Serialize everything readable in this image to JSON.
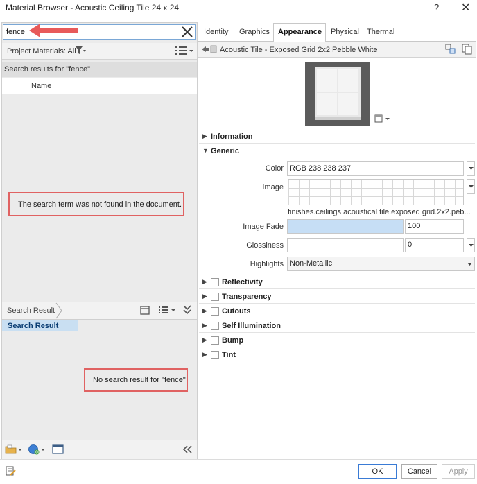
{
  "window": {
    "title": "Material Browser - Acoustic Ceiling Tile 24 x 24",
    "help_label": "?",
    "close_label": "✕"
  },
  "left_panel": {
    "search": {
      "value": "fence"
    },
    "project_materials_label": "Project Materials: All",
    "search_results_label": "Search results for \"fence\"",
    "column_name": "Name",
    "not_found_message": "The search term was not found in the document."
  },
  "search_result_panel": {
    "breadcrumb": "Search Result",
    "tree_item": "Search Result",
    "no_result_message": "No search result for \"fence\""
  },
  "tabs": [
    {
      "label": "Identity"
    },
    {
      "label": "Graphics"
    },
    {
      "label": "Appearance"
    },
    {
      "label": "Physical"
    },
    {
      "label": "Thermal"
    }
  ],
  "asset": {
    "name": "Acoustic Tile - Exposed Grid 2x2 Pebble White"
  },
  "sections": {
    "information": "Information",
    "generic": "Generic",
    "reflectivity": "Reflectivity",
    "transparency": "Transparency",
    "cutouts": "Cutouts",
    "self_illumination": "Self Illumination",
    "bump": "Bump",
    "tint": "Tint"
  },
  "generic": {
    "color_label": "Color",
    "color_value": "RGB 238 238 237",
    "image_label": "Image",
    "image_path": "finishes.ceilings.acoustical tile.exposed grid.2x2.peb...",
    "image_fade_label": "Image Fade",
    "image_fade_value": "100",
    "glossiness_label": "Glossiness",
    "glossiness_value": "0",
    "highlights_label": "Highlights",
    "highlights_value": "Non-Metallic"
  },
  "buttons": {
    "ok": "OK",
    "cancel": "Cancel",
    "apply": "Apply"
  },
  "colors": {
    "accent": "#3a7bd5",
    "highlight_box": "#e06262",
    "selection": "#c9dff2",
    "fade_bar": "#c6def5"
  }
}
